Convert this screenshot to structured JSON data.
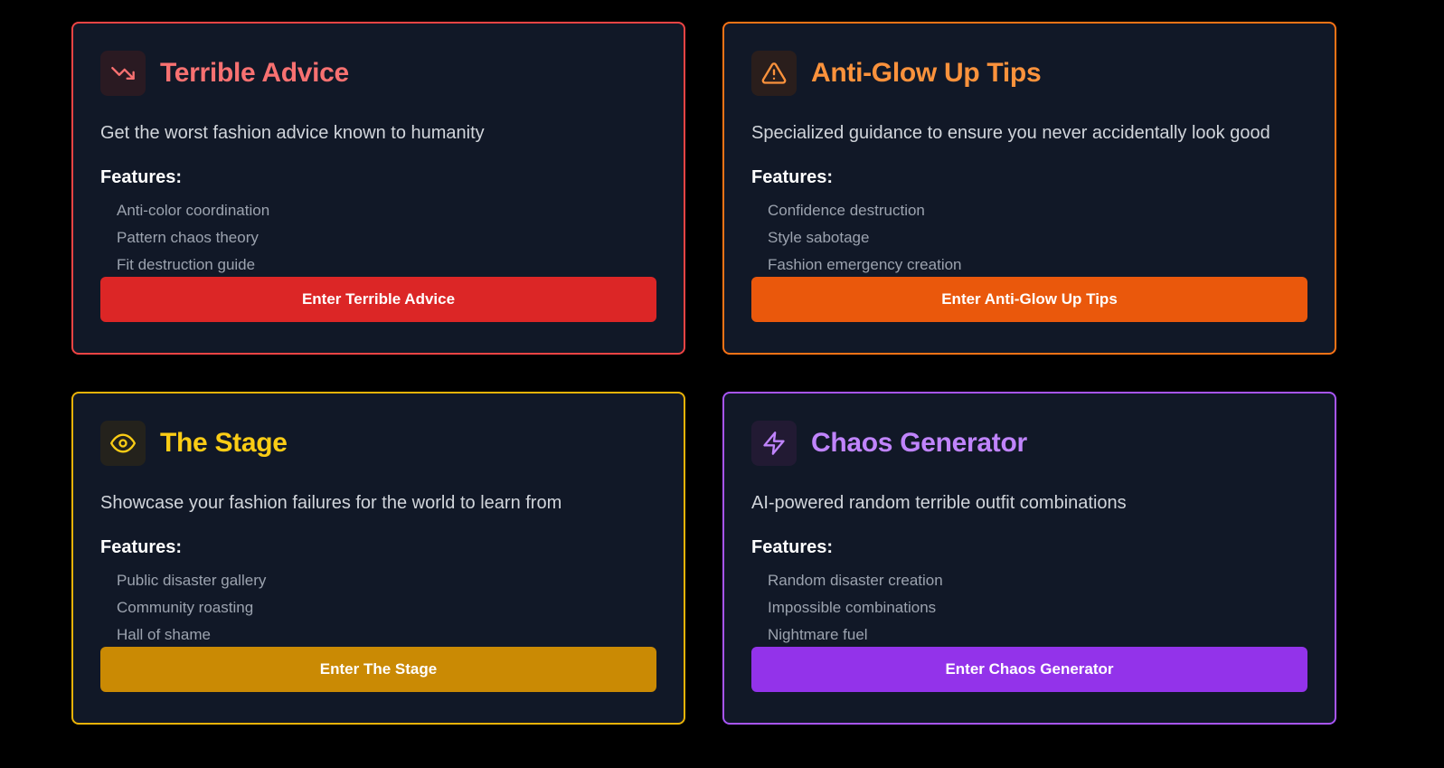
{
  "cards": [
    {
      "title": "Terrible Advice",
      "icon": "trending-down-icon",
      "description": "Get the worst fashion advice known to humanity",
      "features_label": "Features:",
      "features": [
        "Anti-color coordination",
        "Pattern chaos theory",
        "Fit destruction guide"
      ],
      "button_label": "Enter Terrible Advice",
      "colors": {
        "border": "#ef4444",
        "title": "#f87171",
        "icon": "#f87171",
        "icon_bg": "#2a1a22",
        "button": "#dc2626"
      }
    },
    {
      "title": "Anti-Glow Up Tips",
      "icon": "alert-triangle-icon",
      "description": "Specialized guidance to ensure you never accidentally look good",
      "features_label": "Features:",
      "features": [
        "Confidence destruction",
        "Style sabotage",
        "Fashion emergency creation"
      ],
      "button_label": "Enter Anti-Glow Up Tips",
      "colors": {
        "border": "#f97316",
        "title": "#fb923c",
        "icon": "#fb923c",
        "icon_bg": "#2a1e1c",
        "button": "#ea580c"
      }
    },
    {
      "title": "The Stage",
      "icon": "eye-icon",
      "description": "Showcase your fashion failures for the world to learn from",
      "features_label": "Features:",
      "features": [
        "Public disaster gallery",
        "Community roasting",
        "Hall of shame"
      ],
      "button_label": "Enter The Stage",
      "colors": {
        "border": "#eab308",
        "title": "#facc15",
        "icon": "#facc15",
        "icon_bg": "#24221c",
        "button": "#ca8a04"
      }
    },
    {
      "title": "Chaos Generator",
      "icon": "lightning-bolt-icon",
      "description": "AI-powered random terrible outfit combinations",
      "features_label": "Features:",
      "features": [
        "Random disaster creation",
        "Impossible combinations",
        "Nightmare fuel"
      ],
      "button_label": "Enter Chaos Generator",
      "colors": {
        "border": "#a855f7",
        "title": "#c084fc",
        "icon": "#c084fc",
        "icon_bg": "#221a33",
        "button": "#9333ea"
      }
    }
  ]
}
